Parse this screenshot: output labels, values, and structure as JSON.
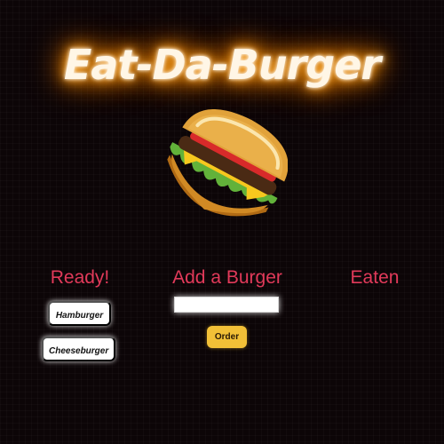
{
  "app": {
    "title": "Eat-Da-Burger"
  },
  "hero": {
    "icon": "burger-illustration-icon"
  },
  "columns": {
    "ready": {
      "heading": "Ready!",
      "burgers": [
        "Hamburger",
        "Cheeseburger"
      ]
    },
    "add": {
      "heading": "Add a Burger",
      "input_value": "",
      "order_label": "Order"
    },
    "eaten": {
      "heading": "Eaten",
      "burgers": []
    }
  },
  "colors": {
    "background": "#0c0507",
    "title_glow": "#ff8800",
    "heading": "#e23a5a",
    "order_button": "#f2c037",
    "chip_background": "#ffffff"
  }
}
